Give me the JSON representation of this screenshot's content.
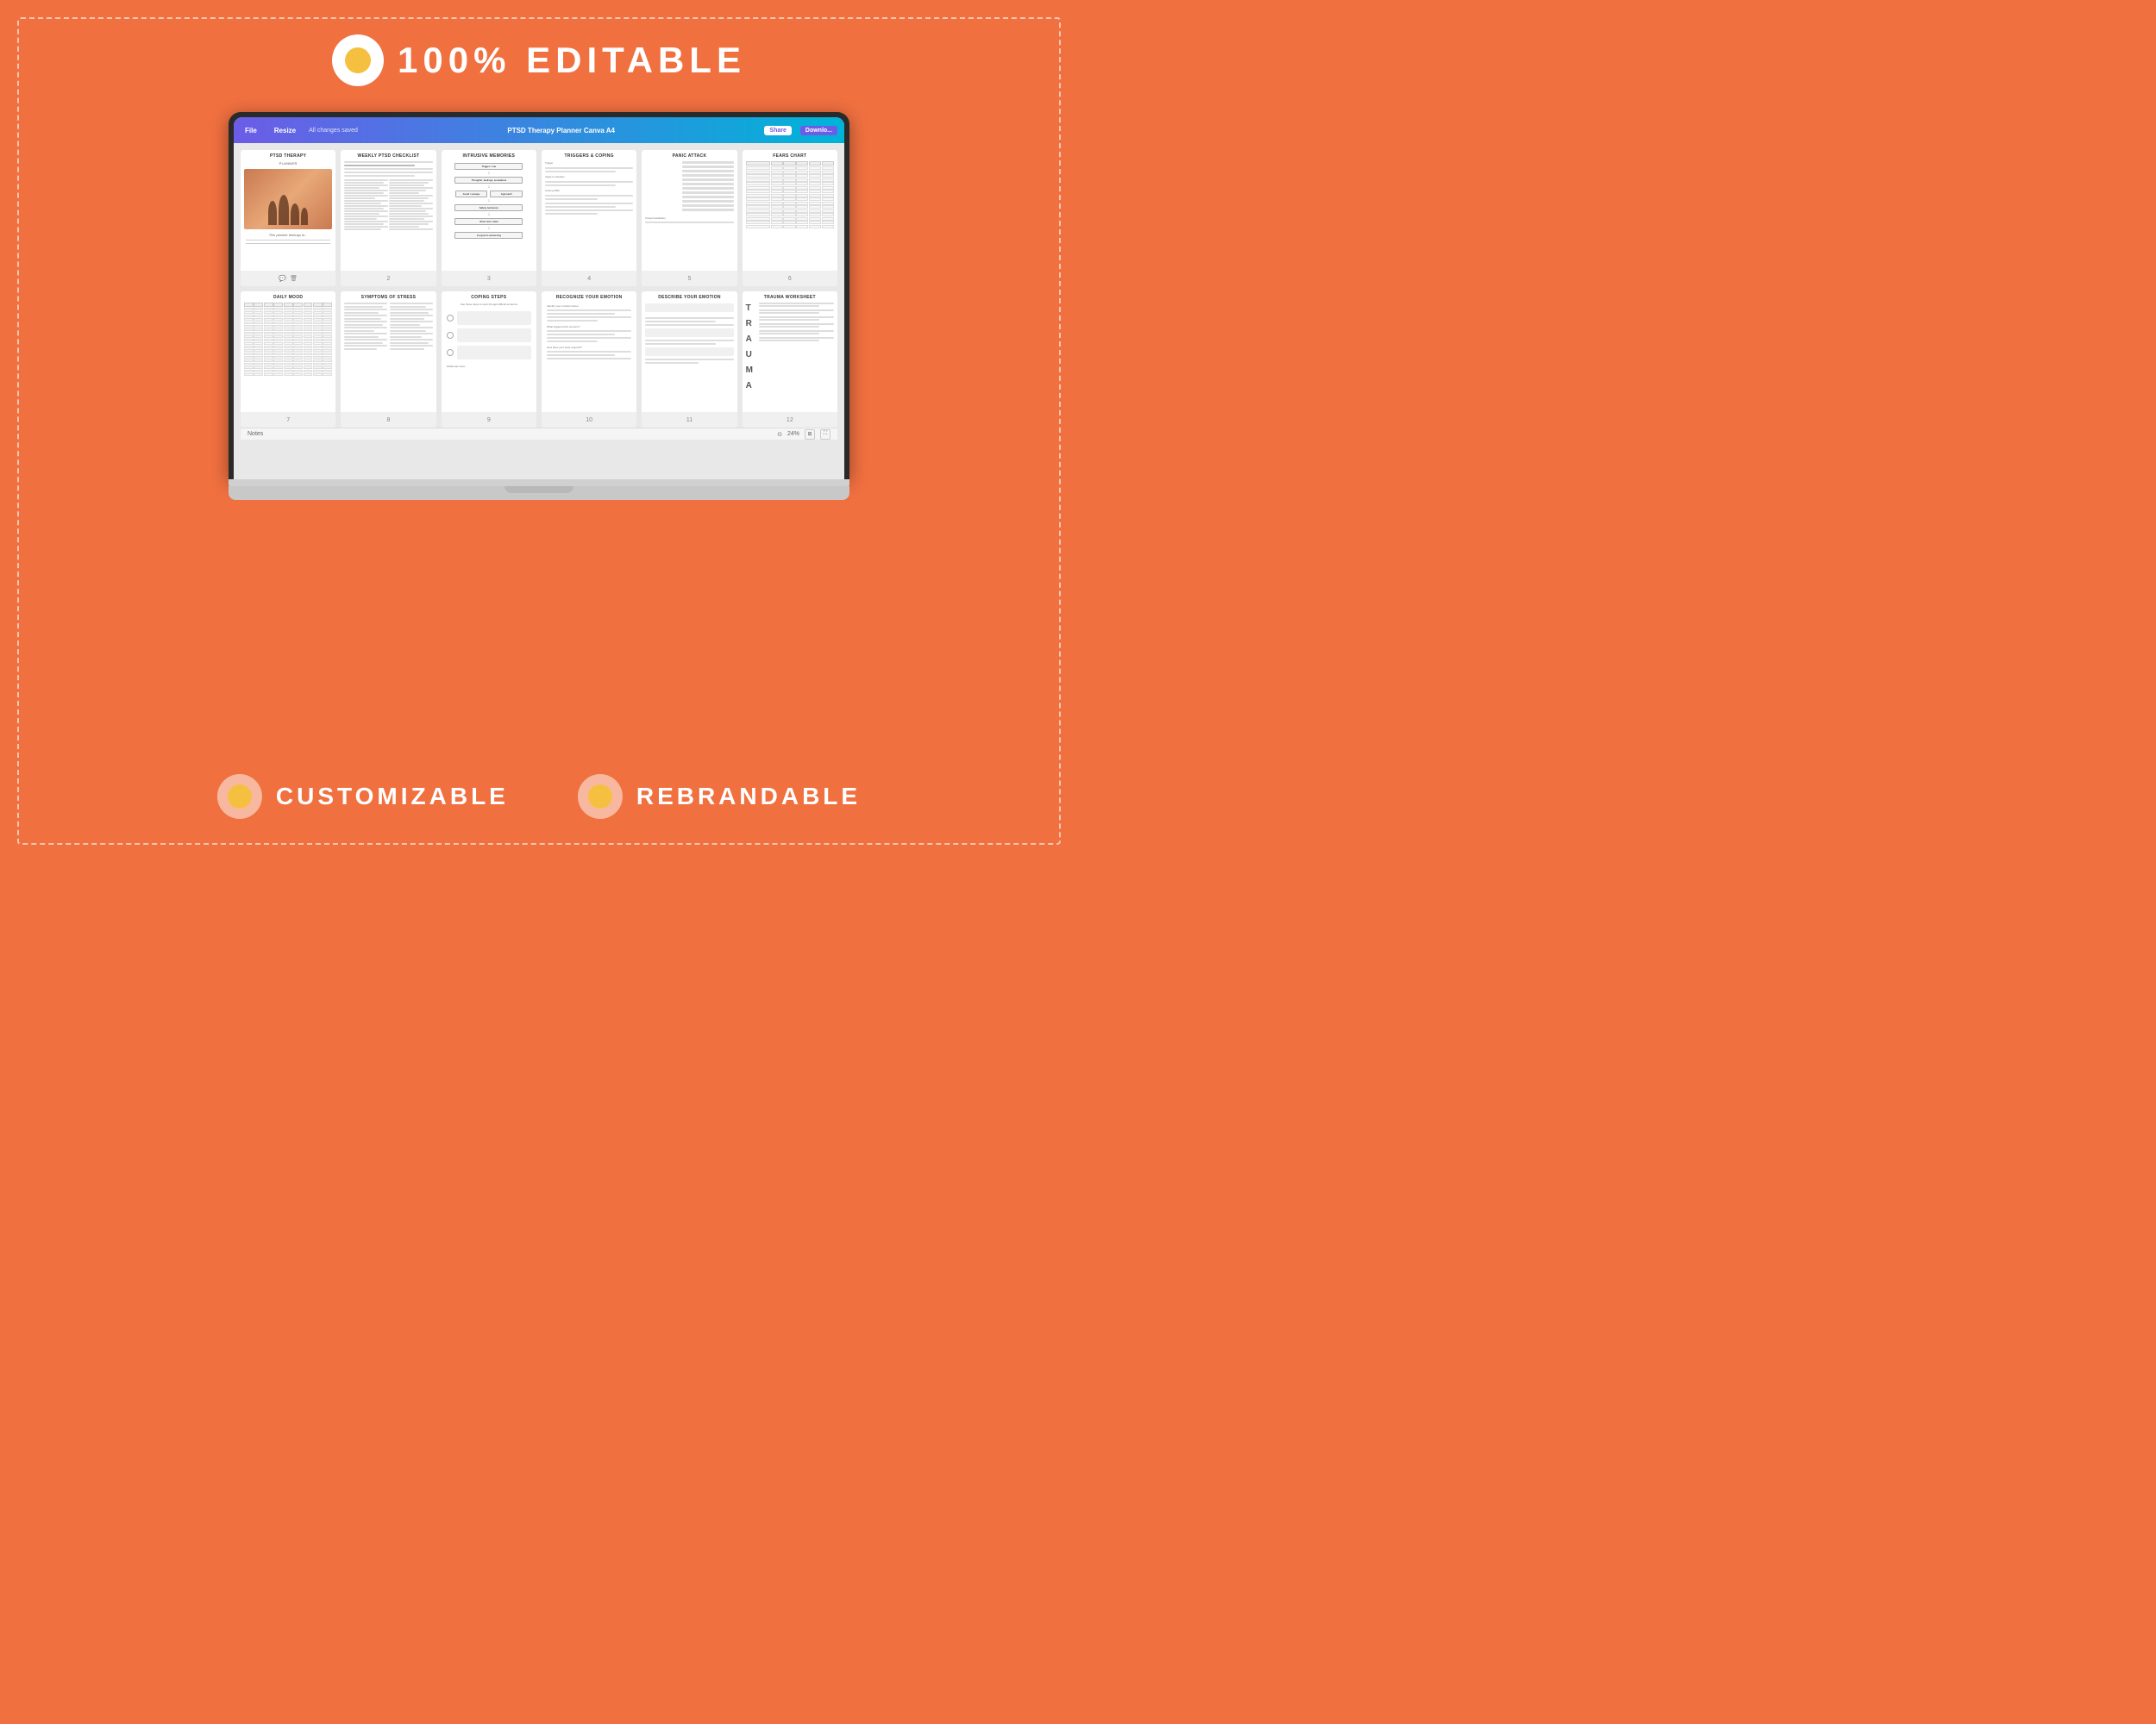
{
  "background": {
    "color": "#F07040"
  },
  "header": {
    "badge": "circle",
    "title": "100% EDITABLE"
  },
  "footer": {
    "left_label": "CUSTOMIZABLE",
    "right_label": "REBRANDABLE"
  },
  "laptop": {
    "canva_bar": {
      "menu": [
        "File",
        "Resize"
      ],
      "status": "All changes saved",
      "title": "PTSD Therapy Planner Canva A4",
      "share_btn": "Share",
      "download_btn": "Downlo..."
    },
    "bottom_bar": {
      "notes_label": "Notes",
      "zoom": "24%"
    }
  },
  "pages": {
    "row1": [
      {
        "id": 1,
        "title": "PTSD THERAPY",
        "subtitle": "PLANNER",
        "type": "cover"
      },
      {
        "id": 2,
        "title": "WEEKLY PTSD CHECKLIST",
        "type": "checklist"
      },
      {
        "id": 3,
        "title": "INTRUSIVE MEMORIES",
        "type": "flowchart"
      },
      {
        "id": 4,
        "title": "TRIGGERS & COPING",
        "type": "triggers"
      },
      {
        "id": 5,
        "title": "PANIC ATTACK",
        "type": "panic"
      },
      {
        "id": 6,
        "title": "FEARS CHART",
        "type": "fears"
      }
    ],
    "row2": [
      {
        "id": 7,
        "title": "DAILY MOOD",
        "type": "mood"
      },
      {
        "id": 8,
        "title": "SYMPTOMS OF STRESS",
        "type": "symptoms"
      },
      {
        "id": 9,
        "title": "COPING STEPS",
        "type": "coping"
      },
      {
        "id": 10,
        "title": "RECOGNIZE YOUR EMOTION",
        "type": "emotion"
      },
      {
        "id": 11,
        "title": "DESCRIBE YOUR EMOTION",
        "type": "describe"
      },
      {
        "id": 12,
        "title": "TRAUMA WORKSHEET",
        "type": "trauma"
      }
    ]
  }
}
